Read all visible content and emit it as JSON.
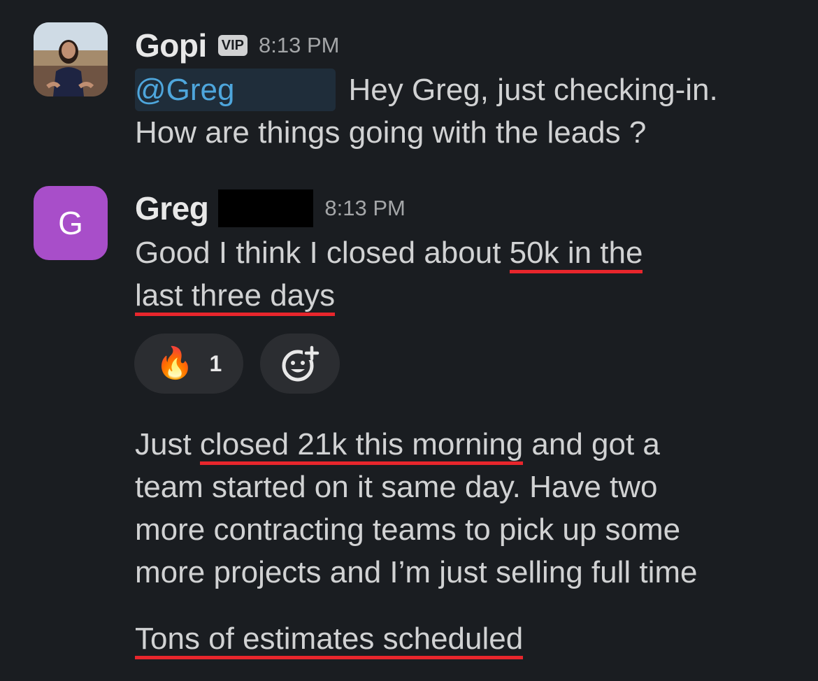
{
  "messages": [
    {
      "author": "Gopi",
      "badge": "VIP",
      "time": "8:13 PM",
      "mention": "@Greg",
      "line1": "Hey Greg, just checking-in.",
      "line2": "How are things going with the leads ?"
    },
    {
      "author": "Greg",
      "avatar_letter": "G",
      "time": "8:13 PM",
      "p1_line1_a": "Good I think I closed about ",
      "p1_line1_b": "50k in the",
      "p1_line2": "last three days",
      "reactions": [
        {
          "emoji": "🔥",
          "count": "1"
        }
      ],
      "p2_line1_a": "Just ",
      "p2_line1_b": "closed 21k this morning",
      "p2_line1_c": " and got a",
      "p2_line2": "team started on it same day. Have two",
      "p2_line3": "more contracting teams to pick up some",
      "p2_line4": "more projects and I’m just selling full time",
      "p3": "Tons of estimates scheduled"
    }
  ],
  "icons": {
    "add_reaction": "add-reaction-icon"
  },
  "colors": {
    "background": "#1a1d21",
    "mention": "#4ea6dc",
    "underline": "#e8262c",
    "avatar_greg": "#a84ec9"
  }
}
